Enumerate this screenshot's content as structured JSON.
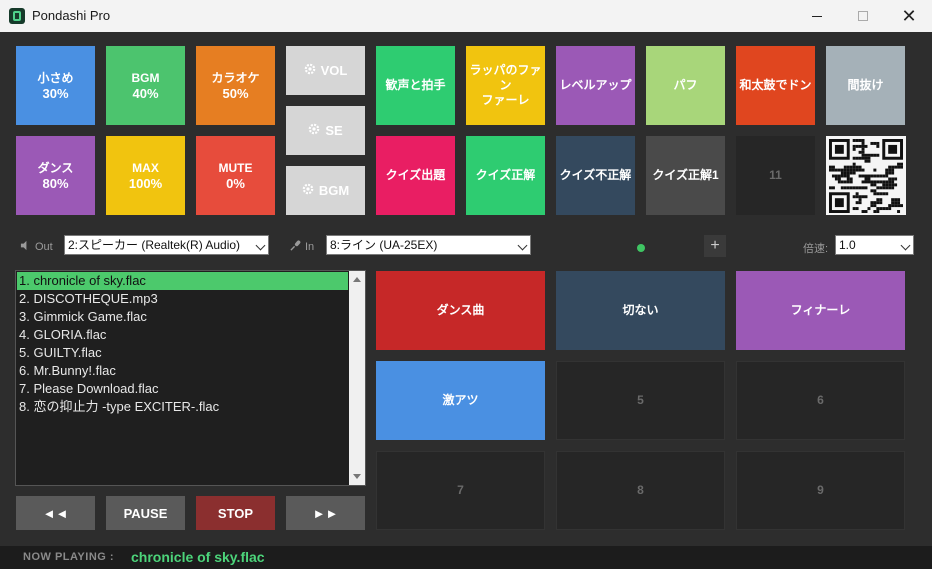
{
  "window": {
    "title": "Pondashi Pro",
    "minimize": "",
    "maximize": "",
    "close": "✕"
  },
  "volume_buttons": [
    {
      "line1": "小さめ",
      "line2": "30%",
      "color": "#4a90e2"
    },
    {
      "line1": "BGM",
      "line2": "40%",
      "color": "#4cc46e"
    },
    {
      "line1": "カラオケ",
      "line2": "50%",
      "color": "#e67e22"
    },
    {
      "line1": "ダンス",
      "line2": "80%",
      "color": "#9b59b6"
    },
    {
      "line1": "MAX",
      "line2": "100%",
      "color": "#f1c40f"
    },
    {
      "line1": "MUTE",
      "line2": "0%",
      "color": "#e74c3c"
    }
  ],
  "channel_buttons": [
    {
      "label": "VOL",
      "icon": "gear-icon"
    },
    {
      "label": "SE",
      "icon": "gear-icon"
    },
    {
      "label": "BGM",
      "icon": "gear-icon"
    }
  ],
  "se_buttons": [
    {
      "label": "歓声と拍手",
      "color": "#2ecc71"
    },
    {
      "label": "ラッパのファンファーレ",
      "line1": "ラッパのファン",
      "line2": "ファーレ",
      "color": "#f1c40f"
    },
    {
      "label": "レベルアップ",
      "color": "#9b59b6"
    },
    {
      "label": "パフ",
      "color": "#a8d67a"
    },
    {
      "label": "和太鼓でドン",
      "color": "#e0461f"
    },
    {
      "label": "間抜け",
      "color": "#a5b1b8"
    },
    {
      "label": "クイズ出題",
      "color": "#e91e63"
    },
    {
      "label": "クイズ正解",
      "color": "#2ecc71"
    },
    {
      "label": "クイズ不正解",
      "color": "#34495e"
    },
    {
      "label": "クイズ正解1",
      "color": "#4a4a4a"
    },
    {
      "label": "11",
      "color": "#262626"
    }
  ],
  "devices": {
    "out_label": "Out",
    "out_value": "2:スピーカー (Realtek(R) Audio)",
    "in_label": "In",
    "in_value": "8:ライン (UA-25EX)",
    "add_label": "+",
    "speed_label": "倍速:",
    "speed_value": "1.0"
  },
  "playlist": [
    "1. chronicle of sky.flac",
    "2. DISCOTHEQUE.mp3",
    "3. Gimmick Game.flac",
    "4. GLORIA.flac",
    "5. GUILTY.flac",
    "6. Mr.Bunny!.flac",
    "7. Please Download.flac",
    "8. 恋の抑止力 -type EXCITER-.flac"
  ],
  "playlist_active_index": 0,
  "controls": [
    {
      "label": "◄◄",
      "name": "rewind-button",
      "color": "#5a5a5a"
    },
    {
      "label": "PAUSE",
      "name": "pause-button",
      "color": "#5a5a5a"
    },
    {
      "label": "STOP",
      "name": "stop-button",
      "color": "#8b2f2f"
    },
    {
      "label": "►►",
      "name": "fast-forward-button",
      "color": "#5a5a5a"
    }
  ],
  "bgm_buttons": [
    {
      "label": "ダンス曲",
      "color": "#c62828"
    },
    {
      "label": "切ない",
      "color": "#34495e"
    },
    {
      "label": "フィナーレ",
      "color": "#9b59b6"
    },
    {
      "label": "激アツ",
      "color": "#4a90e2"
    },
    {
      "label": "5",
      "color": "#262626"
    },
    {
      "label": "6",
      "color": "#262626"
    },
    {
      "label": "7",
      "color": "#262626"
    },
    {
      "label": "8",
      "color": "#262626"
    },
    {
      "label": "9",
      "color": "#262626"
    }
  ],
  "status": {
    "now_playing_label": "NOW PLAYING :",
    "now_playing_value": "chronicle of sky.flac"
  }
}
